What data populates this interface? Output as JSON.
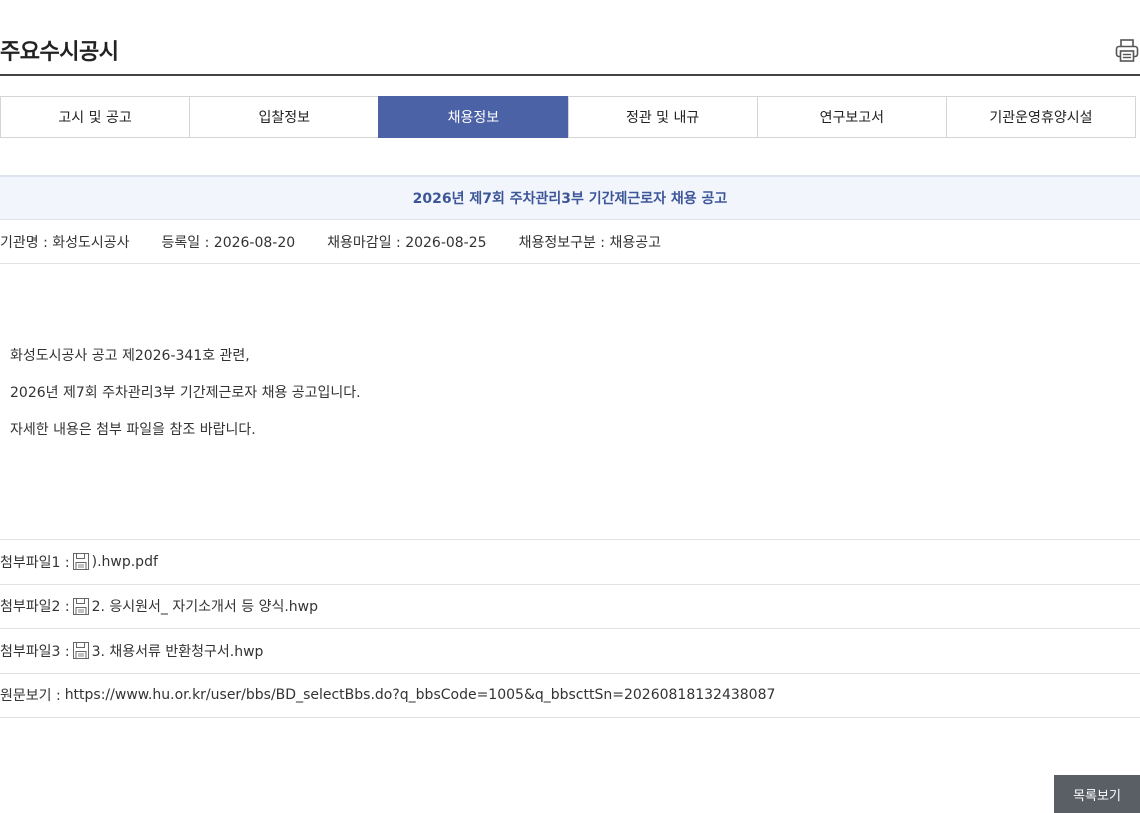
{
  "header": {
    "title": "주요수시공시",
    "print_icon": "printer-icon"
  },
  "tabs": [
    {
      "label": "고시 및 공고",
      "active": false
    },
    {
      "label": "입찰정보",
      "active": false
    },
    {
      "label": "채용정보",
      "active": true
    },
    {
      "label": "정관 및 내규",
      "active": false
    },
    {
      "label": "연구보고서",
      "active": false
    },
    {
      "label": "기관운영휴양시설",
      "active": false
    }
  ],
  "post": {
    "title": "2026년 제7회 주차관리3부 기간제근로자 채용 공고",
    "meta": {
      "agency": "기관명 : 화성도시공사",
      "registered": "등록일 : 2026-08-20",
      "deadline": "채용마감일 : 2026-08-25",
      "category": "채용정보구분 : 채용공고"
    },
    "body": [
      "화성도시공사 공고 제2026-341호 관련,",
      "2026년 제7회 주차관리3부 기간제근로자 채용 공고입니다.",
      "자세한 내용은 첨부 파일을 참조 바랍니다."
    ],
    "attachments": [
      {
        "label": "첨부파일1 :",
        "name": ").hwp.pdf",
        "icon": "floppy-disk-icon"
      },
      {
        "label": "첨부파일2 :",
        "name": "2. 응시원서_ 자기소개서 등 양식.hwp",
        "icon": "floppy-disk-icon"
      },
      {
        "label": "첨부파일3 :",
        "name": "3. 채용서류 반환청구서.hwp",
        "icon": "floppy-disk-icon"
      }
    ],
    "source": {
      "label": "원문보기 :",
      "url": "https://www.hu.or.kr/user/bbs/BD_selectBbs.do?q_bbsCode=1005&q_bbscttSn=20260818132438087"
    }
  },
  "buttons": {
    "list_label": "목록보기"
  },
  "colors": {
    "accent": "#4b62a6",
    "title_text": "#3d5698",
    "title_bg": "#f2f6fc",
    "button_bg": "#5a5f66"
  }
}
